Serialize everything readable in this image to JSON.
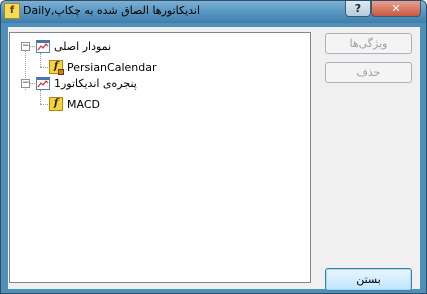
{
  "window": {
    "title": "Daily,اندیکاتورها الصاق شده به چکاپ",
    "app_icon": "indicator-app-icon",
    "help_label": "?",
    "close_label": "✕"
  },
  "tree": {
    "items": [
      {
        "label": "نمودار اصلی",
        "icon": "chart-icon",
        "expander": "−"
      },
      {
        "label": "PersianCalendar",
        "icon": "locked-indicator-icon"
      },
      {
        "label": "پنجره‌ی اندیکاتور1",
        "icon": "chart-icon",
        "expander": "−"
      },
      {
        "label": "MACD",
        "icon": "indicator-icon"
      }
    ]
  },
  "buttons": {
    "properties": "ویژگی‌ها",
    "delete": "حذف",
    "close": "بستن"
  },
  "colors": {
    "titlebar": "#5a99c4",
    "dialog_bg": "#f0f0f0",
    "default_button": "#bee6fd"
  }
}
